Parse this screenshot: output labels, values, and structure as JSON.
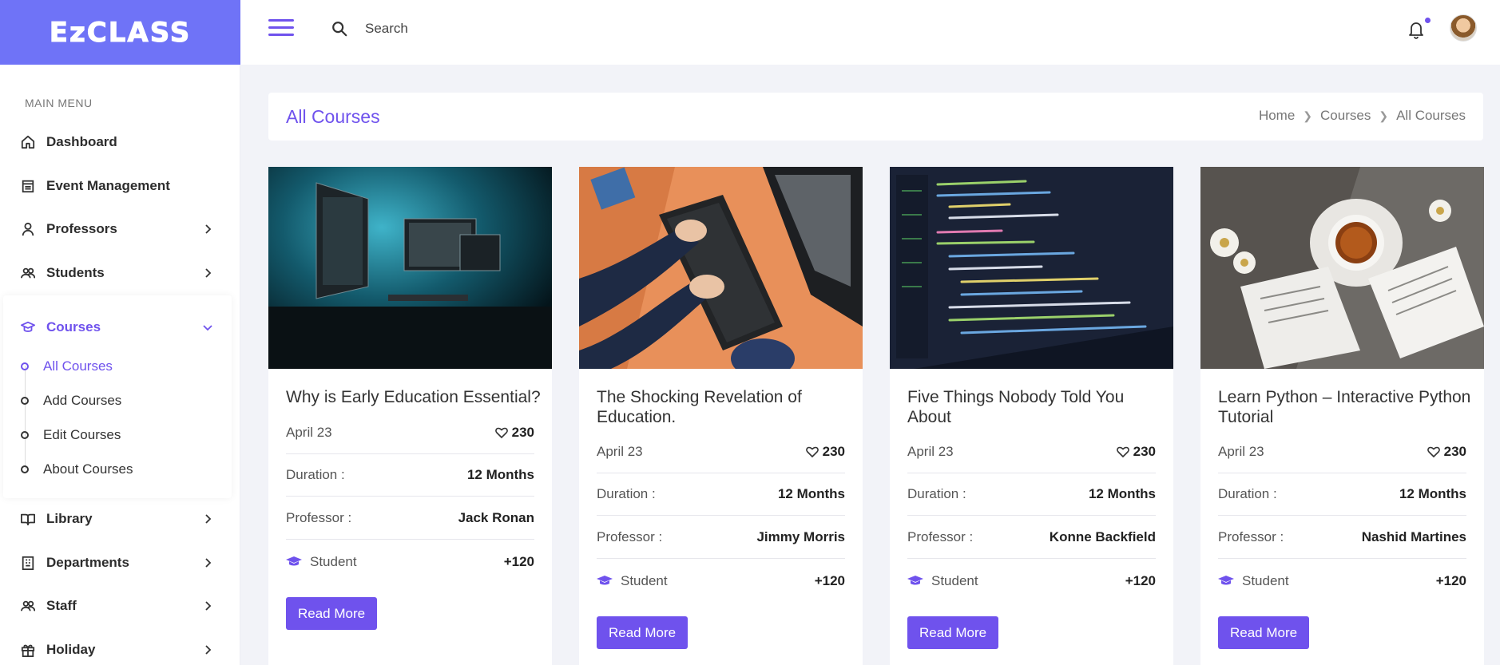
{
  "brand": {
    "logo_text": "EzCLASS",
    "color": "#6f73f7"
  },
  "accent": "#6f52ed",
  "header": {
    "search_placeholder": "Search",
    "search_value": ""
  },
  "sidebar": {
    "menu_title": "MAIN MENU",
    "items": [
      {
        "label": "Dashboard",
        "icon": "home-icon",
        "has_children": false
      },
      {
        "label": "Event Management",
        "icon": "calendar-icon",
        "has_children": false
      },
      {
        "label": "Professors",
        "icon": "user-icon",
        "has_children": true
      },
      {
        "label": "Students",
        "icon": "users-icon",
        "has_children": true
      },
      {
        "label": "Courses",
        "icon": "graduation-cap-icon",
        "has_children": true,
        "expanded": true
      },
      {
        "label": "Library",
        "icon": "book-icon",
        "has_children": true
      },
      {
        "label": "Departments",
        "icon": "building-icon",
        "has_children": true
      },
      {
        "label": "Staff",
        "icon": "users-icon",
        "has_children": true
      },
      {
        "label": "Holiday",
        "icon": "gift-icon",
        "has_children": true
      }
    ],
    "courses_sub": [
      "All Courses",
      "Add Courses",
      "Edit Courses",
      "About Courses"
    ]
  },
  "page": {
    "title": "All Courses",
    "breadcrumb": [
      "Home",
      "Courses",
      "All Courses"
    ]
  },
  "cards": [
    {
      "title": "Why is Early Education Essential?",
      "date": "April 23",
      "likes": "230",
      "duration_label": "Duration :",
      "duration": "12 Months",
      "professor_label": "Professor :",
      "professor": "Jack Ronan",
      "student_label": "Student",
      "students": "+120",
      "button": "Read More"
    },
    {
      "title": "The Shocking Revelation of Education.",
      "date": "April 23",
      "likes": "230",
      "duration_label": "Duration :",
      "duration": "12 Months",
      "professor_label": "Professor :",
      "professor": "Jimmy Morris",
      "student_label": "Student",
      "students": "+120",
      "button": "Read More"
    },
    {
      "title": "Five Things Nobody Told You About",
      "date": "April 23",
      "likes": "230",
      "duration_label": "Duration :",
      "duration": "12 Months",
      "professor_label": "Professor :",
      "professor": "Konne Backfield",
      "student_label": "Student",
      "students": "+120",
      "button": "Read More"
    },
    {
      "title": "Learn Python – Interactive Python Tutorial",
      "date": "April 23",
      "likes": "230",
      "duration_label": "Duration :",
      "duration": "12 Months",
      "professor_label": "Professor :",
      "professor": "Nashid Martines",
      "student_label": "Student",
      "students": "+120",
      "button": "Read More"
    }
  ]
}
